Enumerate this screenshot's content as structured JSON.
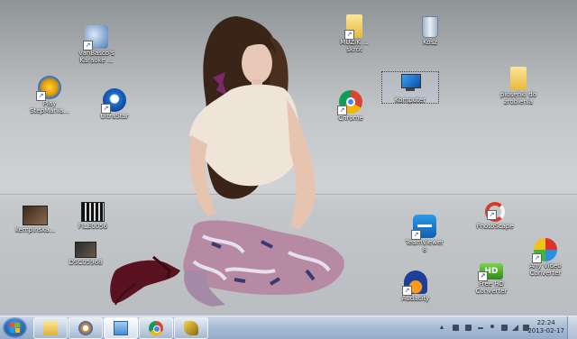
{
  "desktop": {
    "icons": [
      {
        "id": "vanbasco",
        "label": "vanBasco's\nKaraoke ...",
        "icon": "karaoke-icon"
      },
      {
        "id": "play-stepmania",
        "label": "Play\nStepMania...",
        "icon": "stepmania-icon"
      },
      {
        "id": "ultrastar",
        "label": "UltraStar",
        "icon": "ultrastar-icon"
      },
      {
        "id": "muzik",
        "label": "MUZIK ...\nskrót",
        "icon": "folder-icon"
      },
      {
        "id": "kosz",
        "label": "Kosz",
        "icon": "recycle-bin-icon"
      },
      {
        "id": "chrome",
        "label": "Chrome",
        "icon": "chrome-icon"
      },
      {
        "id": "komputer",
        "label": "Komputer",
        "icon": "computer-icon"
      },
      {
        "id": "piosenki",
        "label": "piosenki do\nzrobienia",
        "icon": "folder-icon"
      },
      {
        "id": "kempinska",
        "label": "kempinska...",
        "icon": "video-thumbnail-icon"
      },
      {
        "id": "file0056",
        "label": "FILE0056",
        "icon": "video-file-icon"
      },
      {
        "id": "dsc",
        "label": "DSC05968",
        "icon": "video-thumbnail-icon"
      },
      {
        "id": "teamviewer",
        "label": "TeamViewer\n8",
        "icon": "teamviewer-icon"
      },
      {
        "id": "photoscape",
        "label": "PhotoScape",
        "icon": "photoscape-icon"
      },
      {
        "id": "audacity",
        "label": "Audacity",
        "icon": "audacity-icon"
      },
      {
        "id": "freehd",
        "label": "Free HD\nConverter",
        "icon": "hd-converter-icon"
      },
      {
        "id": "anyvideo",
        "label": "Any Video\nConverter",
        "icon": "any-video-converter-icon"
      }
    ]
  },
  "taskbar": {
    "pinned": [
      {
        "id": "explorer",
        "icon": "folder-icon"
      },
      {
        "id": "media-player",
        "icon": "media-player-icon"
      },
      {
        "id": "picture-viewer",
        "icon": "picture-icon"
      },
      {
        "id": "chrome",
        "icon": "chrome-icon"
      },
      {
        "id": "tool",
        "icon": "tool-icon"
      }
    ],
    "clock": {
      "time": "22:24",
      "date": "2013-02-17"
    }
  }
}
